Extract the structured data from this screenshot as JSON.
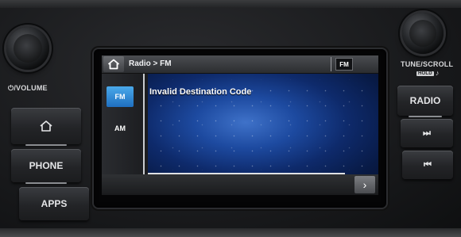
{
  "left_panel": {
    "volume_label": "⏻/VOLUME",
    "buttons": [
      {
        "id": "home",
        "label": ""
      },
      {
        "id": "phone",
        "label": "PHONE"
      },
      {
        "id": "apps",
        "label": "APPS"
      }
    ]
  },
  "right_panel": {
    "tune_label": "TUNE/SCROLL",
    "hold_label": "HOLD",
    "note_glyph": "♪",
    "radio_label": "RADIO",
    "seek_up_glyph": "⏭",
    "seek_down_glyph": "⏮"
  },
  "screen": {
    "breadcrumb": "Radio > FM",
    "band_badge": "FM",
    "sidebar": [
      {
        "label": "FM",
        "active": true
      },
      {
        "label": "AM",
        "active": false
      }
    ],
    "message": "Invalid Destination Code",
    "next_glyph": "›"
  },
  "colors": {
    "screen_blue": "#1d4aa0",
    "active_tab": "#3b95dd",
    "bezel": "#1a1b1d"
  }
}
